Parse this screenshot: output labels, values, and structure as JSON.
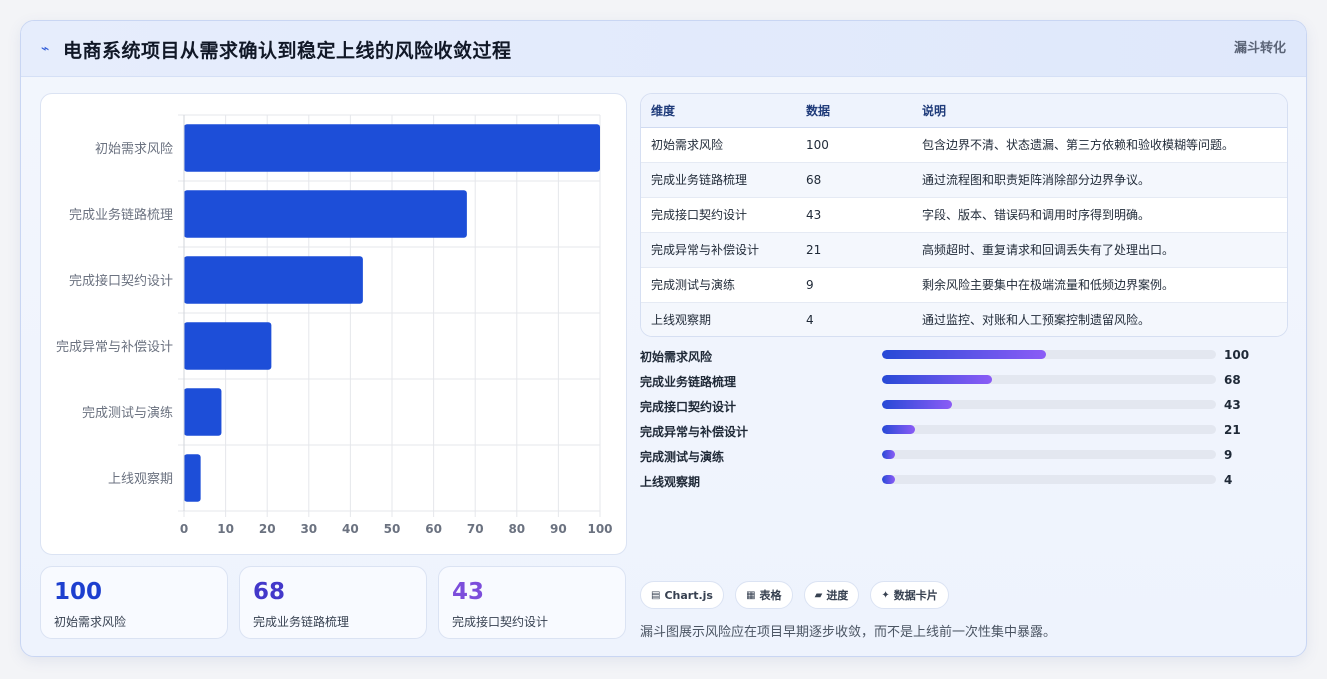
{
  "header": {
    "icon": "trend-icon",
    "title": "电商系统项目从需求确认到稳定上线的风险收敛过程",
    "tag": "漏斗转化"
  },
  "chart_data": {
    "type": "bar",
    "orientation": "horizontal",
    "categories": [
      "初始需求风险",
      "完成业务链路梳理",
      "完成接口契约设计",
      "完成异常与补偿设计",
      "完成测试与演练",
      "上线观察期"
    ],
    "values": [
      100,
      68,
      43,
      21,
      9,
      4
    ],
    "xlim": [
      0,
      100
    ],
    "xticks": [
      0,
      10,
      20,
      30,
      40,
      50,
      60,
      70,
      80,
      90,
      100
    ],
    "grid": true,
    "bar_color": "#1d4ed8"
  },
  "stats": [
    {
      "value": "100",
      "label": "初始需求风险",
      "color": "#1d3fcf"
    },
    {
      "value": "68",
      "label": "完成业务链路梳理",
      "color": "#4338ca"
    },
    {
      "value": "43",
      "label": "完成接口契约设计",
      "color": "#7c4ddb"
    }
  ],
  "table": {
    "headers": [
      "维度",
      "数据",
      "说明"
    ],
    "rows": [
      [
        "初始需求风险",
        "100",
        "包含边界不清、状态遗漏、第三方依赖和验收模糊等问题。"
      ],
      [
        "完成业务链路梳理",
        "68",
        "通过流程图和职责矩阵消除部分边界争议。"
      ],
      [
        "完成接口契约设计",
        "43",
        "字段、版本、错误码和调用时序得到明确。"
      ],
      [
        "完成异常与补偿设计",
        "21",
        "高频超时、重复请求和回调丢失有了处理出口。"
      ],
      [
        "完成测试与演练",
        "9",
        "剩余风险主要集中在极端流量和低频边界案例。"
      ],
      [
        "上线观察期",
        "4",
        "通过监控、对账和人工预案控制遗留风险。"
      ]
    ]
  },
  "progress": [
    {
      "label": "初始需求风险",
      "value": "100",
      "fraction": 0.49
    },
    {
      "label": "完成业务链路梳理",
      "value": "68",
      "fraction": 0.33
    },
    {
      "label": "完成接口契约设计",
      "value": "43",
      "fraction": 0.21
    },
    {
      "label": "完成异常与补偿设计",
      "value": "21",
      "fraction": 0.1
    },
    {
      "label": "完成测试与演练",
      "value": "9",
      "fraction": 0.04
    },
    {
      "label": "上线观察期",
      "value": "4",
      "fraction": 0.04
    }
  ],
  "chips": [
    {
      "icon": "chart-icon",
      "glyph": "▤",
      "label": "Chart.js"
    },
    {
      "icon": "table-icon",
      "glyph": "▦",
      "label": "表格"
    },
    {
      "icon": "progress-icon",
      "glyph": "▰",
      "label": "进度"
    },
    {
      "icon": "sparkle-icon",
      "glyph": "✦",
      "label": "数据卡片"
    }
  ],
  "caption": "漏斗图展示风险应在项目早期逐步收敛，而不是上线前一次性集中暴露。"
}
